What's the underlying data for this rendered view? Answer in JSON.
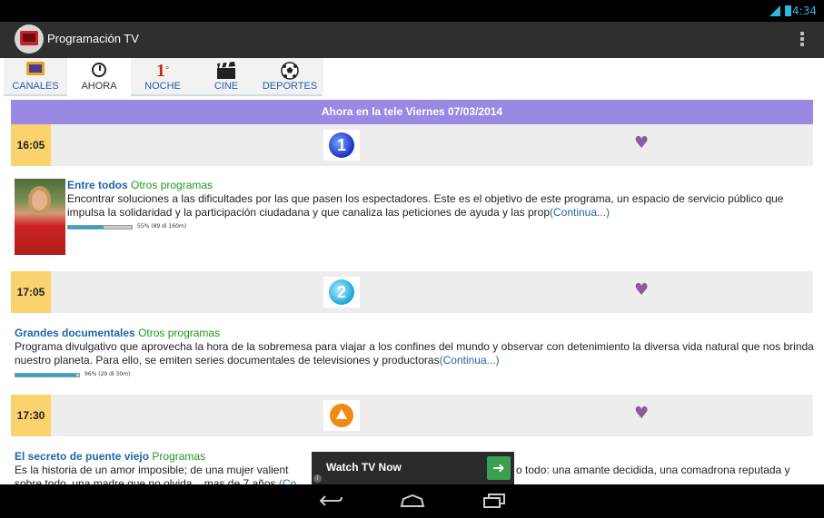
{
  "status_bar": {
    "time": "4:34",
    "signal_icon": "signal-3g-icon",
    "battery_icon": "battery-icon",
    "accent_color": "#33b5e5"
  },
  "action_bar": {
    "app_icon": "tv-app-icon",
    "title": "Programación TV",
    "overflow_icon": "overflow-menu-icon"
  },
  "tabs": [
    {
      "label": "CANALES",
      "icon": "tv-icon",
      "active": false
    },
    {
      "label": "AHORA",
      "icon": "alarm-clock-icon",
      "active": true
    },
    {
      "label": "NOCHE",
      "icon": "first-icon",
      "glyph": "1",
      "glyph_sup": "°",
      "active": false
    },
    {
      "label": "CINE",
      "icon": "clapperboard-icon",
      "active": false
    },
    {
      "label": "DEPORTES",
      "icon": "soccer-ball-icon",
      "active": false
    }
  ],
  "banner": {
    "text": "Ahora en la tele Viernes 07/03/2014",
    "color": "#9b88e2"
  },
  "schedule": [
    {
      "time": "16:05",
      "channel_logo": "la1-logo",
      "channel_glyph": "1",
      "favorite_icon": "heart-icon",
      "program": {
        "title": "Entre todos",
        "genre": "Otros programas",
        "description": "Encontrar soluciones a las dificultades por las que pasen los espectadores. Este es el objetivo de este programa, un espacio de servicio público que impulsa la solidaridad y la participación ciudadana y que canaliza las peticiones de ayuda y las prop",
        "more": "(Continua...)",
        "progress_text": "55% (89 di 160m)",
        "progress": 0.55,
        "has_thumbnail": true
      }
    },
    {
      "time": "17:05",
      "channel_logo": "la2-logo",
      "channel_glyph": "2",
      "favorite_icon": "heart-icon",
      "program": {
        "title": "Grandes documentales",
        "genre": "Otros programas",
        "description": "Programa divulgativo que aprovecha la hora de la sobremesa para viajar a los confines del mundo y observar con detenimiento la diversa vida natural que nos brinda nuestro planeta. Para ello, se emiten series documentales de televisiones y productoras",
        "more": "(Continua...)",
        "progress_text": "96% (29 di 30m)",
        "progress": 0.96,
        "has_thumbnail": false
      }
    },
    {
      "time": "17:30",
      "channel_logo": "antena3-logo",
      "favorite_icon": "heart-icon",
      "program": {
        "title": "El secreto de puente viejo",
        "genre": "Programas",
        "description_visible_left": "Es la historia de un amor imposible; de una mujer valient",
        "description_visible_right": "o todo: una amante decidida, una comadrona reputada y",
        "description_line2": "sobre todo, una madre que no olvida... mas de 7 años",
        "more_partial": "(Co",
        "has_thumbnail": false
      }
    }
  ],
  "ad": {
    "label": "Watch TV Now",
    "button_icon": "arrow-right-icon",
    "info_icon": "ad-info-icon"
  },
  "nav_bar": {
    "back_icon": "back-icon",
    "home_icon": "home-icon",
    "recent_icon": "recent-apps-icon"
  }
}
